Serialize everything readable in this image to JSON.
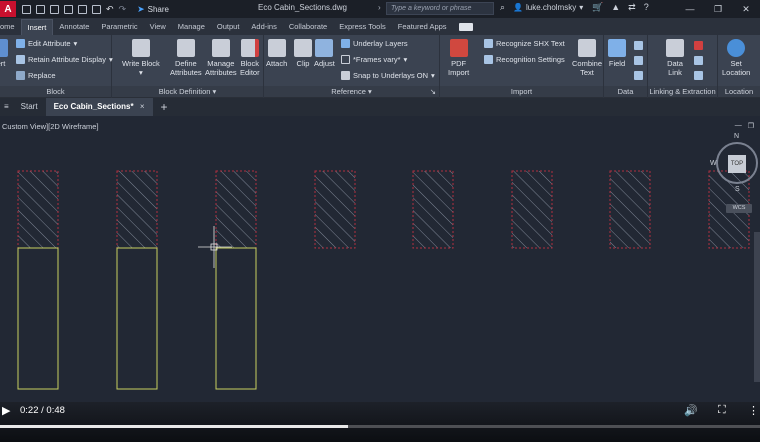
{
  "titlebar": {
    "app_logo": "A",
    "share_label": "Share",
    "file_title": "Eco Cabin_Sections.dwg",
    "search_placeholder": "Type a keyword or phrase",
    "user": "luke.cholmsky"
  },
  "tabs": [
    {
      "label": "ome"
    },
    {
      "label": "Insert",
      "active": true
    },
    {
      "label": "Annotate"
    },
    {
      "label": "Parametric"
    },
    {
      "label": "View"
    },
    {
      "label": "Manage"
    },
    {
      "label": "Output"
    },
    {
      "label": "Add-ins"
    },
    {
      "label": "Collaborate"
    },
    {
      "label": "Express Tools"
    },
    {
      "label": "Featured Apps"
    }
  ],
  "ribbon": {
    "block": {
      "title": "Block",
      "insert": "ert",
      "edit_attribute": "Edit Attribute",
      "retain_display": "Retain Attribute Display",
      "replace": "Replace"
    },
    "block_definition": {
      "title": "Block Definition",
      "write_block": "Write Block",
      "define_attributes_1": "Define",
      "define_attributes_2": "Attributes",
      "manage_attributes_1": "Manage",
      "manage_attributes_2": "Attributes",
      "block_editor_1": "Block",
      "block_editor_2": "Editor"
    },
    "reference": {
      "title": "Reference",
      "attach": "Attach",
      "clip": "Clip",
      "adjust": "Adjust",
      "underlay_layers": "Underlay Layers",
      "frames_vary": "*Frames vary*",
      "snap_underlays": "Snap to Underlays ON"
    },
    "import": {
      "title": "Import",
      "pdf_import_1": "PDF",
      "pdf_import_2": "Import",
      "recognize_shx": "Recognize SHX Text",
      "recognition_settings": "Recognition Settings",
      "combine_text_1": "Combine",
      "combine_text_2": "Text"
    },
    "data": {
      "title": "Data",
      "field": "Field"
    },
    "linking": {
      "title": "Linking & Extraction",
      "data_link_1": "Data",
      "data_link_2": "Link"
    },
    "location": {
      "title": "Location",
      "set_location_1": "Set",
      "set_location_2": "Location"
    }
  },
  "doctabs": {
    "start": "Start",
    "active": "Eco Cabin_Sections*"
  },
  "canvas": {
    "view_label": "Custom View][2D Wireframe]",
    "viewcube": {
      "face": "TOP",
      "north": "N",
      "south": "S",
      "west": "W",
      "wcs": "WCS"
    }
  },
  "video": {
    "time": "0:22 / 0:48",
    "progress": 0.458
  },
  "colors": {
    "hatch": "#b03040",
    "outline": "#c8d060",
    "ribbon": "#3b4351",
    "canvas": "#222834"
  }
}
